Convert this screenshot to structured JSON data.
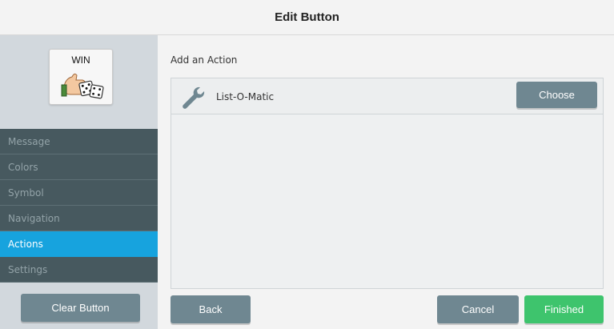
{
  "dialog": {
    "title": "Edit Button"
  },
  "preview": {
    "label": "WIN",
    "symbol_icon": "thumbs-up-dice-icon"
  },
  "menu": {
    "items": [
      {
        "label": "Message",
        "active": false
      },
      {
        "label": "Colors",
        "active": false
      },
      {
        "label": "Symbol",
        "active": false
      },
      {
        "label": "Navigation",
        "active": false
      },
      {
        "label": "Actions",
        "active": true
      },
      {
        "label": "Settings",
        "active": false
      }
    ]
  },
  "sidebar": {
    "clear_button_label": "Clear Button"
  },
  "main": {
    "section_label": "Add an Action",
    "actions": [
      {
        "icon": "wrench-icon",
        "name": "List-O-Matic",
        "choose_label": "Choose"
      }
    ]
  },
  "footer": {
    "back_label": "Back",
    "cancel_label": "Cancel",
    "finished_label": "Finished"
  },
  "colors": {
    "active_menu": "#17a3de",
    "menu_bg": "#47595f",
    "button_gray": "#6f8791",
    "button_green": "#3ec46d"
  }
}
